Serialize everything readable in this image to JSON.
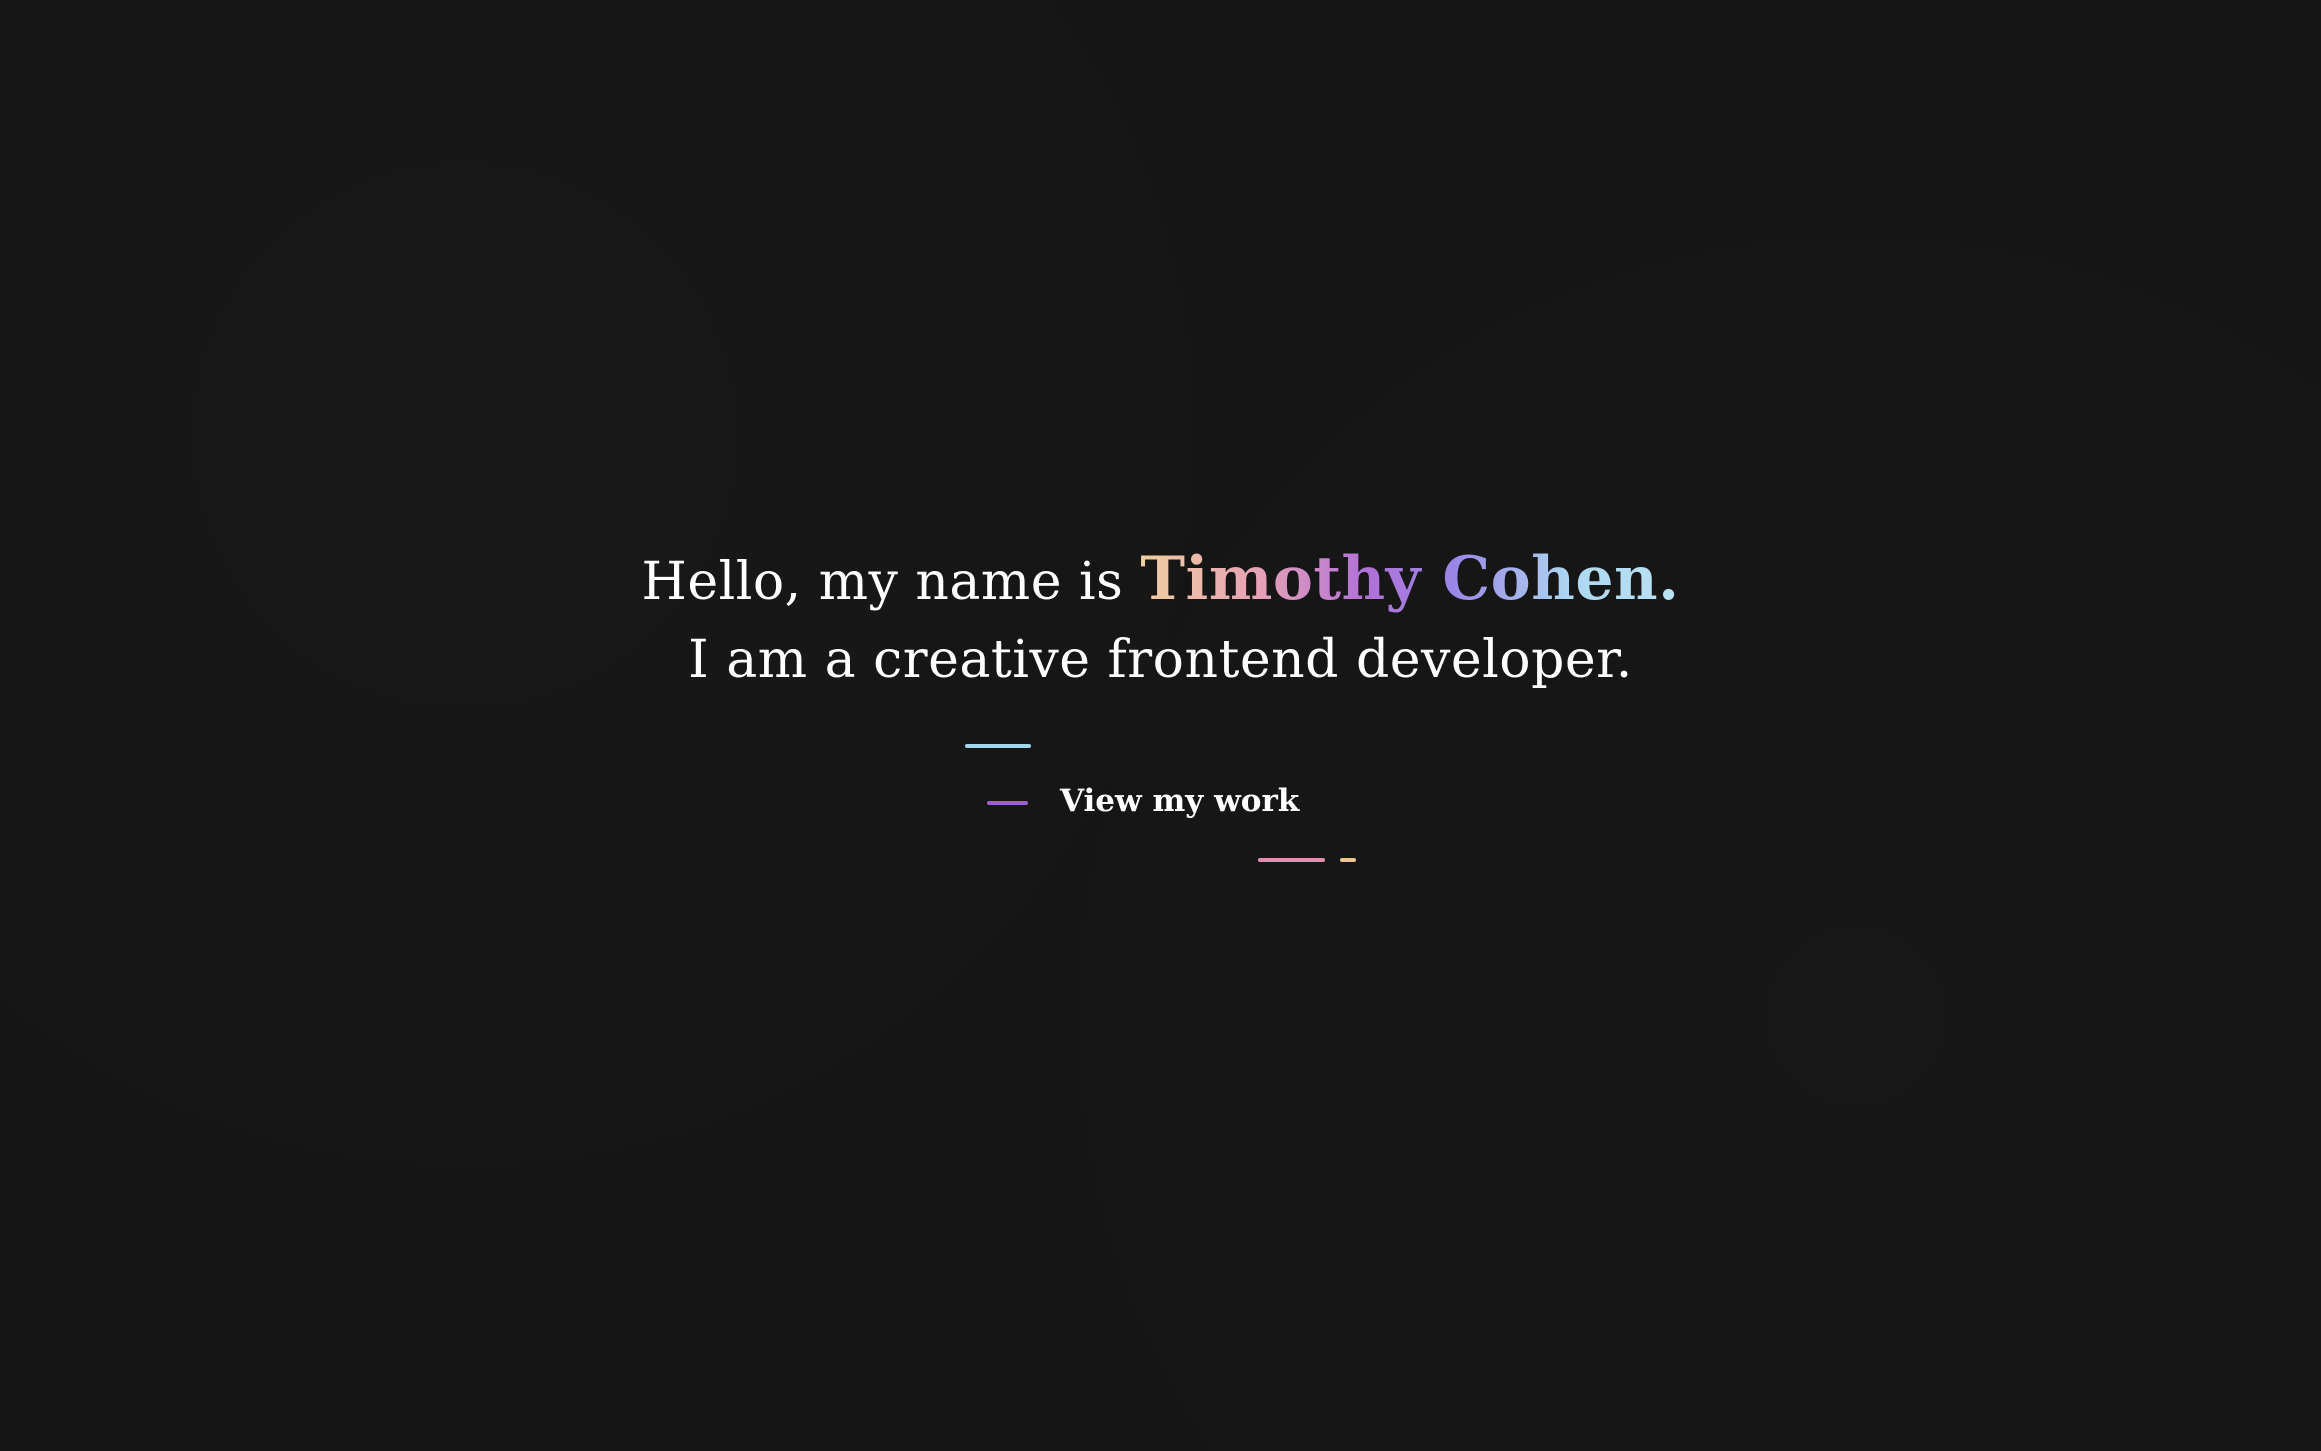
{
  "hero": {
    "greeting": "Hello, my name is",
    "name": "Timothy Cohen.",
    "tagline": "I am a creative frontend developer."
  },
  "cta": {
    "label": "View my work"
  },
  "colors": {
    "background": "#151515",
    "text": "#ffffff",
    "accent_cyan": "#9fd6ee",
    "accent_purple": "#9a5fd6",
    "accent_pink": "#e08fb0",
    "accent_peach": "#efc58f"
  }
}
